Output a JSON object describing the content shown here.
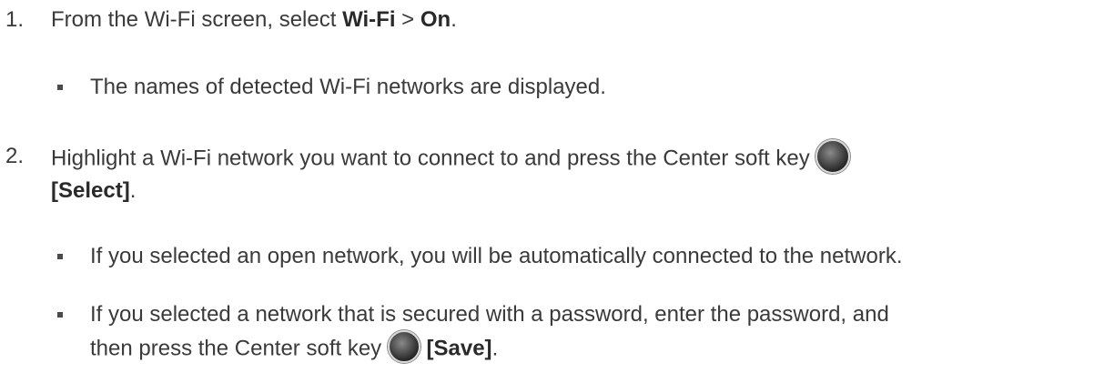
{
  "steps": [
    {
      "number": "1.",
      "text_before": "From the Wi-Fi screen, select ",
      "bold1": "Wi-Fi",
      "sep": " > ",
      "bold2": "On",
      "end": ".",
      "bullets": [
        "The names of detected Wi-Fi networks are displayed."
      ]
    },
    {
      "number": "2.",
      "text_line1": "Highlight a Wi-Fi network you want to connect to and press the Center soft key ",
      "key_label": "[Select]",
      "end": ".",
      "bullets": [
        "If you selected an open network, you will be automatically connected to the network.",
        "If you selected a network that is secured with a password, enter the password, and"
      ],
      "bullet3_line2_before": "then press the Center soft key ",
      "bullet3_key_label": "[Save]",
      "bullet3_end": "."
    }
  ],
  "icons": {
    "center_soft_key": "center-soft-key-icon"
  }
}
